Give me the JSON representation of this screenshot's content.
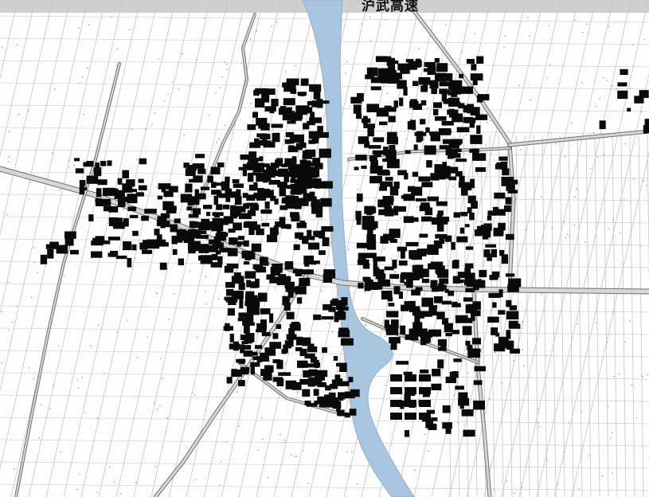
{
  "map": {
    "expressway_label": "沪武高速",
    "colors": {
      "river": "#a9c6e0",
      "river_edge": "#8fb0cc",
      "building": "#0a0a0a",
      "road": "#6f6f6f",
      "road_fill": "#d7d7d7",
      "parcel_line": "#c4c4c4",
      "background": "#fdfdfd",
      "top_bar": "#cfcfcf"
    }
  }
}
